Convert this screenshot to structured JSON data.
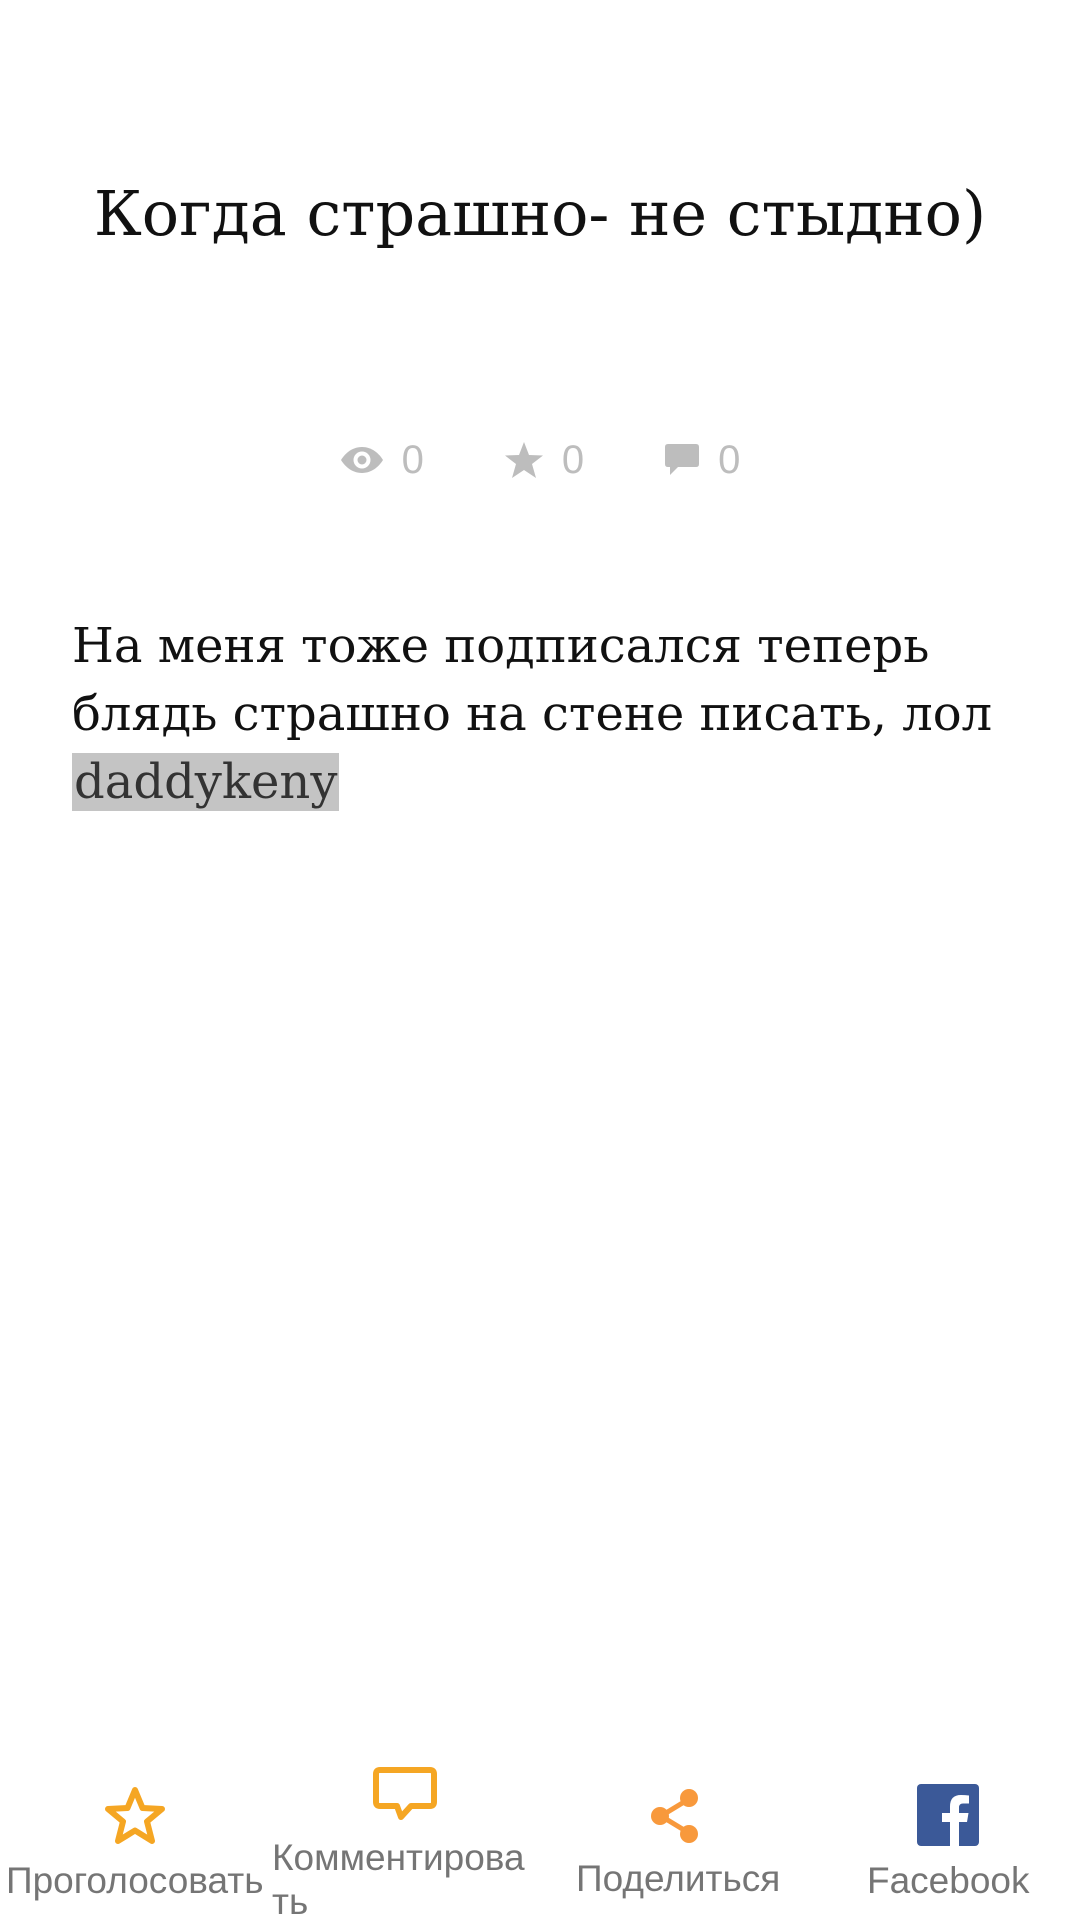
{
  "post": {
    "title": "Когда страшно- не стыдно)",
    "stats": {
      "views": "0",
      "votes": "0",
      "comments": "0"
    },
    "body": "На меня тоже подписался теперь блядь страшно на стене писать, лол",
    "mention": "daddykeny"
  },
  "actions": {
    "vote_label": "Проголосовать",
    "comment_label": "Комментировать",
    "share_label": "Поделиться",
    "facebook_label": "Facebook"
  },
  "colors": {
    "accent": "#F5A623",
    "share_accent": "#F8993C",
    "facebook_blue": "#3B5998",
    "stat_gray": "#BDBDBD",
    "label_gray": "#757575",
    "mention_bg": "#C4C4C4"
  },
  "icons": {
    "views": "eye-icon",
    "votes": "star-icon",
    "comments": "speech-bubble-icon",
    "vote_action": "star-outline-icon",
    "comment_action": "comment-outline-icon",
    "share_action": "share-icon",
    "facebook_action": "facebook-icon"
  }
}
